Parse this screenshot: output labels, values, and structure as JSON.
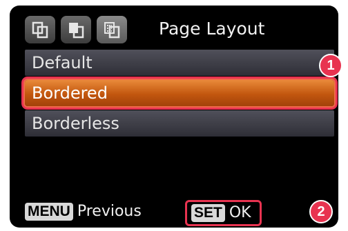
{
  "header": {
    "title": "Page Layout",
    "tabs": [
      {
        "icon": "single-page-icon"
      },
      {
        "icon": "page-copy-icon"
      },
      {
        "icon": "page-layout-icon",
        "active": true
      }
    ]
  },
  "menu": {
    "items": [
      {
        "label": "Default"
      },
      {
        "label": "Bordered",
        "selected": true
      },
      {
        "label": "Borderless"
      }
    ]
  },
  "footer": {
    "menu_key": "MENU",
    "menu_label": "Previous",
    "set_key": "SET",
    "set_label": "OK"
  },
  "callouts": {
    "badge1": "1",
    "badge2": "2"
  },
  "colors": {
    "selected_bg": "#c2560e",
    "highlight": "#e83350",
    "screen_bg": "#000000"
  }
}
